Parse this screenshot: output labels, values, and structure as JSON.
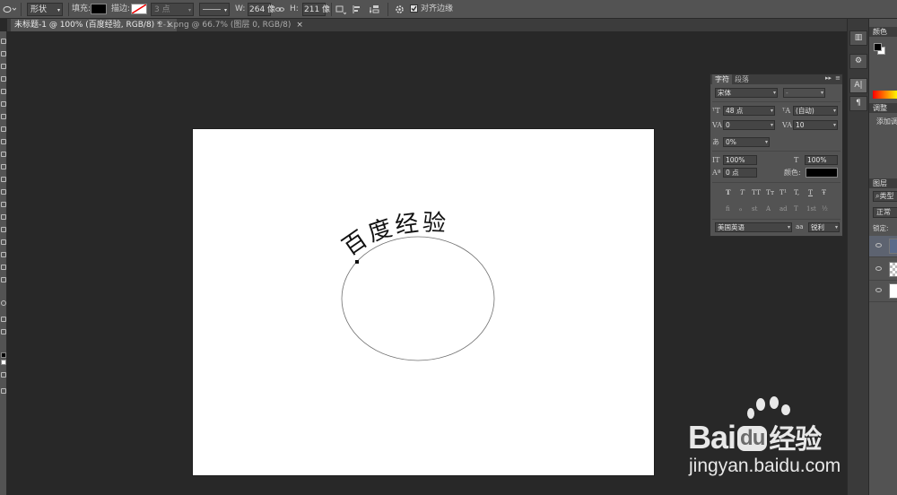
{
  "options_bar": {
    "shape_mode": "形状",
    "fill_label": "填充:",
    "stroke_label": "描边:",
    "stroke_width": "3 点",
    "width_label": "W:",
    "width_value": "264 像",
    "height_label": "H:",
    "height_value": "211 像",
    "align_edges_label": "对齐边缘"
  },
  "tabs": [
    {
      "label": "未标题-1 @ 100% (百度经验, RGB/8) *",
      "close": "×"
    },
    {
      "label": "2-1.png @ 66.7% (图层 0, RGB/8)",
      "close": "×"
    }
  ],
  "canvas": {
    "path_text": "百度经验"
  },
  "character_panel": {
    "tab_character": "字符",
    "tab_paragraph": "段落",
    "font_family": "宋体",
    "font_style": "-",
    "font_size": "48 点",
    "leading": "(自动)",
    "kerning": "0",
    "tracking": "10",
    "vertical_scale_pct": "0%",
    "scale_vertical": "100%",
    "scale_horizontal": "100%",
    "baseline_shift": "0 点",
    "color_label": "颜色:",
    "language": "美国英语",
    "aa_label": "aa",
    "antialias": "锐利",
    "style_buttons": [
      "T",
      "T",
      "TT",
      "Tт",
      "T¹",
      "T,",
      "T",
      "Ŧ"
    ],
    "opentype_buttons": [
      "fi",
      "ℴ",
      "st",
      "A",
      "ad",
      "T",
      "1st",
      "½"
    ]
  },
  "right_panels": {
    "color_tab": "颜色",
    "adjustments_tab": "调整",
    "adjustments_hint": "添加调",
    "layers_tab": "图层",
    "layer_filter": "类型",
    "blend_mode": "正常",
    "lock_label": "锁定:"
  },
  "watermark": {
    "brand": "Bai",
    "du": "du",
    "cn": "经验",
    "url": "jingyan.baidu.com"
  }
}
